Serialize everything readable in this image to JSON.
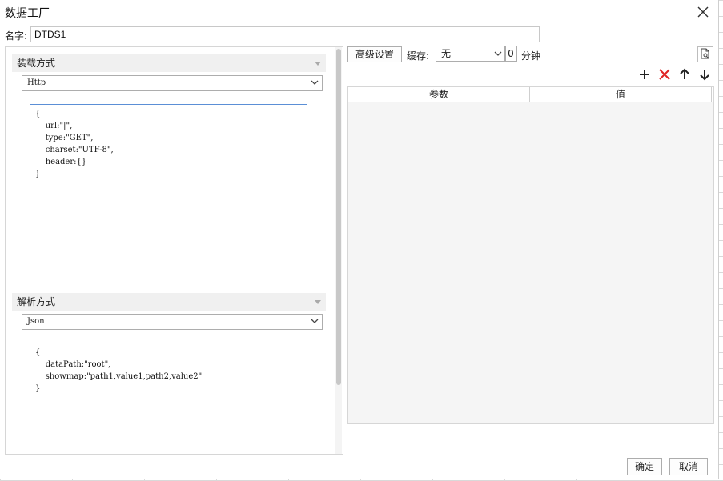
{
  "window": {
    "title": "数据工厂"
  },
  "name_field": {
    "label": "名字:",
    "value": "DTDS1"
  },
  "load_section": {
    "header": "装载方式",
    "method": "Http",
    "code": "{\n    url:\"|\",\n    type:\"GET\",\n    charset:\"UTF-8\",\n    header:{}\n}"
  },
  "parse_section": {
    "header": "解析方式",
    "method": "Json",
    "code": "{\n    dataPath:\"root\",\n    showmap:\"path1,value1,path2,value2\"\n}"
  },
  "toolbar": {
    "advanced_label": "高级设置",
    "cache_label": "缓存:",
    "cache_value": "无",
    "minutes_value": "0",
    "minutes_label": "分钟"
  },
  "param_table": {
    "columns": [
      "参数",
      "值"
    ]
  },
  "footer": {
    "ok_label": "确定",
    "cancel_label": "取消"
  },
  "colors": {
    "add": "#222222",
    "delete": "#e02424",
    "focus_border": "#5b8fd6"
  }
}
